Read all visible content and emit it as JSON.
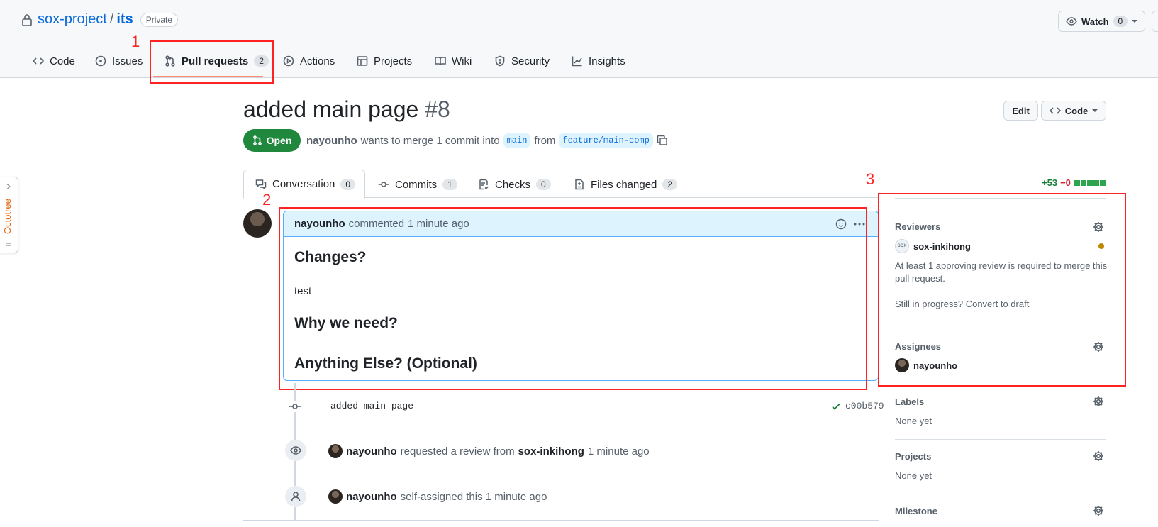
{
  "repo": {
    "owner": "sox-project",
    "separator": "/",
    "name": "its",
    "visibility": "Private"
  },
  "watch": {
    "label": "Watch",
    "count": "0"
  },
  "nav_tabs": [
    {
      "label": "Code",
      "icon": "code-icon"
    },
    {
      "label": "Issues",
      "icon": "issue-icon"
    },
    {
      "label": "Pull requests",
      "icon": "pull-request-icon",
      "count": "2",
      "active": true
    },
    {
      "label": "Actions",
      "icon": "play-icon"
    },
    {
      "label": "Projects",
      "icon": "table-icon"
    },
    {
      "label": "Wiki",
      "icon": "book-icon"
    },
    {
      "label": "Security",
      "icon": "shield-icon"
    },
    {
      "label": "Insights",
      "icon": "graph-icon"
    }
  ],
  "annotations": {
    "box1": "1",
    "box2": "2",
    "box3": "3",
    "color": "#ff2222"
  },
  "pr": {
    "title": "added main page",
    "number": "#8",
    "state": "Open",
    "author": "nayounho",
    "merge_text": "wants to merge 1 commit into",
    "base_branch": "main",
    "from_text": "from",
    "head_branch": "feature/main-comp",
    "edit_label": "Edit",
    "code_label": "Code"
  },
  "pr_tabs": [
    {
      "label": "Conversation",
      "count": "0"
    },
    {
      "label": "Commits",
      "count": "1"
    },
    {
      "label": "Checks",
      "count": "0"
    },
    {
      "label": "Files changed",
      "count": "2"
    }
  ],
  "diffstat": {
    "additions": "+53",
    "deletions": "−0"
  },
  "comment": {
    "author": "nayounho",
    "action": "commented",
    "time": "1 minute ago",
    "heading1": "Changes?",
    "body1": "test",
    "heading2": "Why we need?",
    "heading3": "Anything Else? (Optional)"
  },
  "timeline": {
    "commit_message": "added main page",
    "commit_sha": "c00b579",
    "event1": {
      "actor": "nayounho",
      "text": "requested a review from",
      "target": "sox-inkihong",
      "time": "1 minute ago"
    },
    "event2": {
      "actor": "nayounho",
      "text": "self-assigned this 1 minute ago"
    }
  },
  "sidebar": {
    "reviewers_title": "Reviewers",
    "reviewer": "sox-inkihong",
    "reviewer_avatar_text": "SOX",
    "review_required": "At least 1 approving review is required to merge this pull request.",
    "draft_text": "Still in progress? Convert to draft",
    "assignees_title": "Assignees",
    "assignee": "nayounho",
    "labels_title": "Labels",
    "labels_value": "None yet",
    "projects_title": "Projects",
    "projects_value": "None yet",
    "milestone_title": "Milestone"
  },
  "octotree": {
    "label": "Octotree"
  },
  "colors": {
    "accent": "#0969da",
    "open_green": "#1f883d",
    "pending": "#bf8700",
    "active_tab": "#fd8c73"
  }
}
